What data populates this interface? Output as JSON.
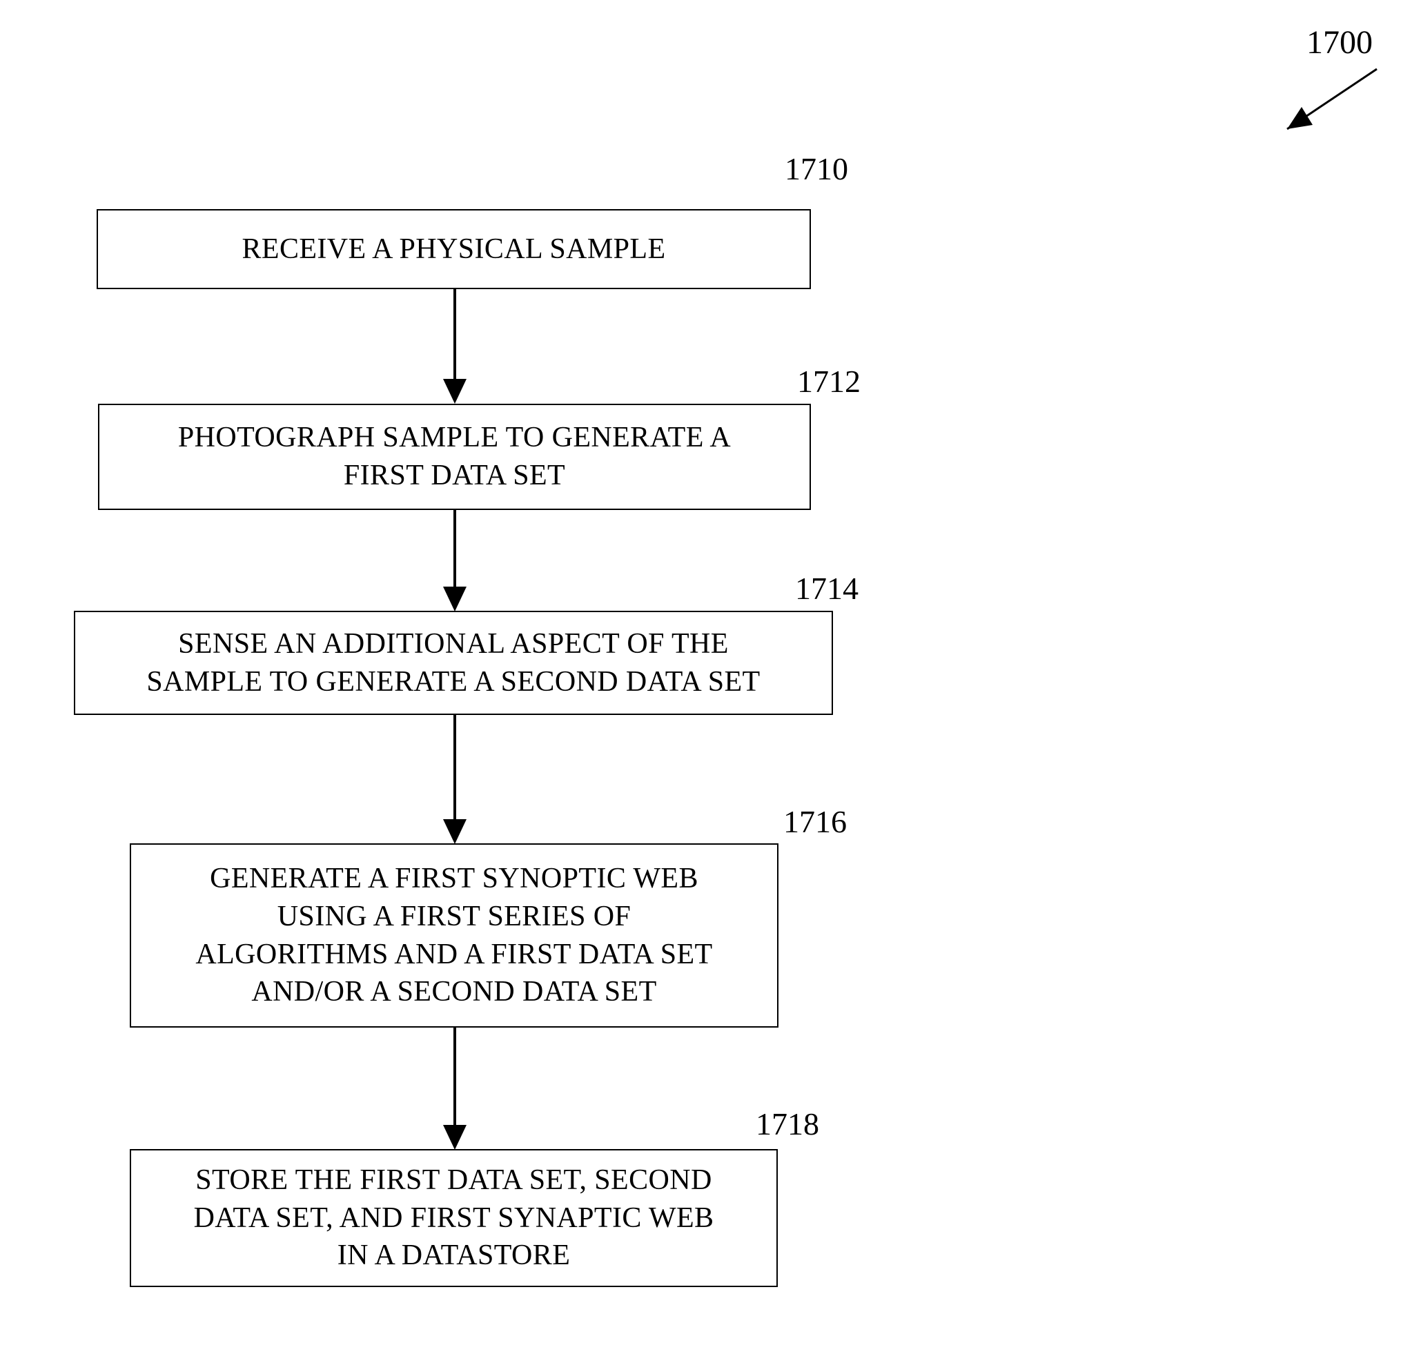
{
  "figure": {
    "main_reference": "1700",
    "type": "process flow diagram"
  },
  "steps": [
    {
      "ref": "1710",
      "text": "RECEIVE A PHYSICAL SAMPLE",
      "lines": [
        "RECEIVE A PHYSICAL SAMPLE"
      ]
    },
    {
      "ref": "1712",
      "text": "PHOTOGRAPH SAMPLE TO GENERATE A\nFIRST DATA SET",
      "lines": [
        "PHOTOGRAPH SAMPLE TO GENERATE A",
        "FIRST DATA SET"
      ]
    },
    {
      "ref": "1714",
      "text": "SENSE AN ADDITIONAL ASPECT OF THE\nSAMPLE TO GENERATE A SECOND DATA SET",
      "lines": [
        "SENSE AN ADDITIONAL ASPECT OF THE",
        "SAMPLE TO GENERATE A SECOND DATA SET"
      ]
    },
    {
      "ref": "1716",
      "text": "GENERATE A FIRST SYNOPTIC WEB\nUSING A FIRST SERIES OF\nALGORITHMS AND A FIRST DATA SET\nAND/OR A SECOND DATA SET",
      "lines": [
        "GENERATE A FIRST SYNOPTIC WEB",
        "USING A FIRST SERIES OF",
        "ALGORITHMS AND A FIRST DATA SET",
        "AND/OR A SECOND DATA SET"
      ]
    },
    {
      "ref": "1718",
      "text": "STORE THE FIRST DATA SET, SECOND\nDATA SET, AND FIRST SYNAPTIC WEB\nIN A DATASTORE",
      "lines": [
        "STORE THE FIRST DATA SET, SECOND",
        "DATA SET, AND FIRST SYNAPTIC WEB",
        "IN A DATASTORE"
      ]
    }
  ],
  "colors": {
    "stroke": "#000000",
    "background": "#ffffff"
  }
}
